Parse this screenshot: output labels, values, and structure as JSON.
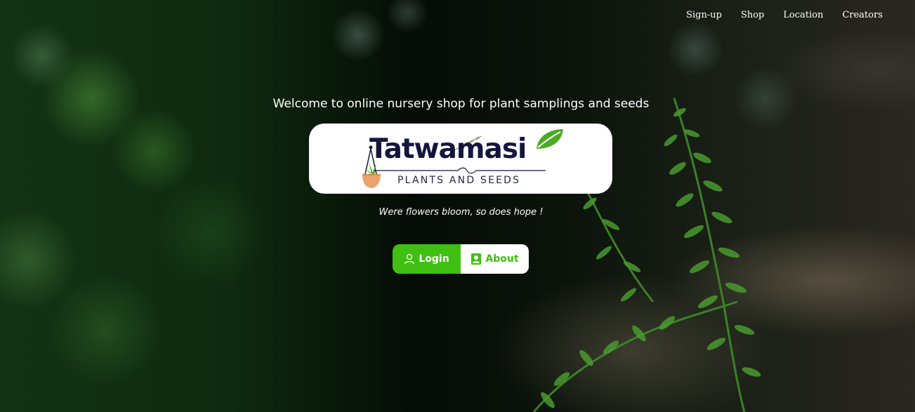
{
  "nav": {
    "items": [
      {
        "label": "Sign-up"
      },
      {
        "label": "Shop"
      },
      {
        "label": "Location"
      },
      {
        "label": "Creators"
      }
    ]
  },
  "hero": {
    "welcome": "Welcome to online nursery shop for plant samplings and seeds",
    "tagline": "Were flowers bloom, so does hope !"
  },
  "logo": {
    "title": "Tatwamasi",
    "subtitle": "PLANTS AND SEEDS"
  },
  "buttons": {
    "login": {
      "label": "Login",
      "icon": "user-icon"
    },
    "about": {
      "label": "About",
      "icon": "contact-card-icon"
    }
  },
  "colors": {
    "accent": "#3fbf12",
    "logo_text": "#14163d",
    "text": "#ffffff"
  }
}
